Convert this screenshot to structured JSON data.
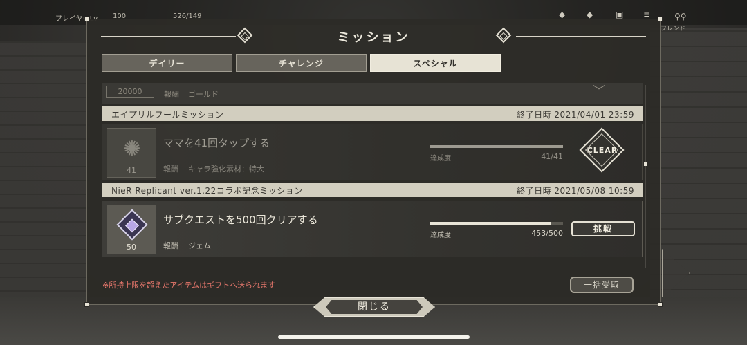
{
  "hud": {
    "player_label": "プレイヤーLv",
    "level_value": "100",
    "stamina": "526/149",
    "friend_label": "フレンド"
  },
  "panel": {
    "title": "ミッション"
  },
  "tabs": [
    {
      "label": "デイリー",
      "active": false
    },
    {
      "label": "チャレンジ",
      "active": false
    },
    {
      "label": "スペシャル",
      "active": true
    }
  ],
  "partial_row": {
    "count": "20000",
    "reward_label": "報酬",
    "reward_value": "ゴールド"
  },
  "sections": [
    {
      "title": "エイプリルフールミッション",
      "end_date": "終了日時 2021/04/01 23:59",
      "mission": {
        "title": "ママを41回タップする",
        "thumb_qty": "41",
        "reward_label": "報酬",
        "reward_value": "キャラ強化素材：特大",
        "progress_label": "達成度",
        "progress_count": "41/41",
        "progress_fraction": 1.0,
        "status": "CLEAR"
      }
    },
    {
      "title": "NieR Replicant ver.1.22コラボ記念ミッション",
      "end_date": "終了日時 2021/05/08 10:59",
      "mission": {
        "title": "サブクエストを500回クリアする",
        "thumb_qty": "50",
        "reward_label": "報酬",
        "reward_value": "ジェム",
        "progress_label": "達成度",
        "progress_count": "453/500",
        "progress_fraction": 0.906,
        "action_label": "挑戦"
      }
    }
  ],
  "footer": {
    "note": "※所持上限を超えたアイテムはギフトへ送られます",
    "bulk_receive_label": "一括受取",
    "close_label": "閉じる"
  }
}
